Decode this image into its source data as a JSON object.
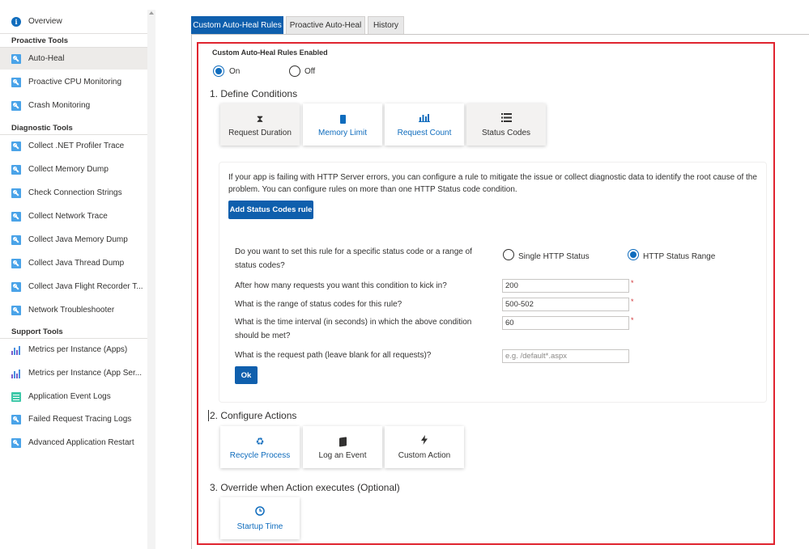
{
  "sidebar": {
    "overview": "Overview",
    "sections": {
      "proactive": "Proactive Tools",
      "diagnostic": "Diagnostic Tools",
      "support": "Support Tools"
    },
    "proactive_items": [
      "Auto-Heal",
      "Proactive CPU Monitoring",
      "Crash Monitoring"
    ],
    "diagnostic_items": [
      "Collect .NET Profiler Trace",
      "Collect Memory Dump",
      "Check Connection Strings",
      "Collect Network Trace",
      "Collect Java Memory Dump",
      "Collect Java Thread Dump",
      "Collect Java Flight Recorder T...",
      "Network Troubleshooter"
    ],
    "support_items": [
      "Metrics per Instance (Apps)",
      "Metrics per Instance (App Ser...",
      "Application Event Logs",
      "Failed Request Tracing Logs",
      "Advanced Application Restart"
    ]
  },
  "tabs": [
    "Custom Auto-Heal Rules",
    "Proactive Auto-Heal",
    "History"
  ],
  "rules": {
    "enabled_label": "Custom Auto-Heal Rules Enabled",
    "on_label": "On",
    "off_label": "Off",
    "enabled": true
  },
  "conditions": {
    "heading": "1. Define Conditions",
    "cards": [
      {
        "label": "Request Duration",
        "icon": "hourglass-icon"
      },
      {
        "label": "Memory Limit",
        "icon": "memory-icon"
      },
      {
        "label": "Request Count",
        "icon": "bar-chart-icon"
      },
      {
        "label": "Status Codes",
        "icon": "list-icon"
      }
    ],
    "selected": [
      "Request Duration",
      "Status Codes"
    ]
  },
  "status_codes": {
    "description_line1": "If your app is failing with HTTP Server errors, you can configure a rule to mitigate the issue or collect diagnostic data to identify the root cause of the",
    "description_line2": "problem. You can configure rules on more than one HTTP Status code condition.",
    "add_button": "Add Status Codes rule",
    "q_type_line1": "Do you want to set this rule for a specific status code or a range of",
    "q_type_line2": "status codes?",
    "single_label": "Single HTTP Status",
    "range_label": "HTTP Status Range",
    "selected_type": "HTTP Status Range",
    "q_requests": "After how many requests you want this condition to kick in?",
    "requests_value": "200",
    "q_range": "What is the range of status codes for this rule?",
    "range_value": "500-502",
    "q_interval_line1": "What is the time interval (in seconds) in which the above condition",
    "q_interval_line2": "should be met?",
    "interval_value": "60",
    "q_path": "What is the request path (leave blank for all requests)?",
    "path_placeholder": "e.g. /default*.aspx",
    "required_mark": "*",
    "ok_button": "Ok"
  },
  "actions": {
    "heading": "2. Configure Actions",
    "cards": [
      {
        "label": "Recycle Process",
        "icon": "recycle-icon"
      },
      {
        "label": "Log an Event",
        "icon": "book-icon"
      },
      {
        "label": "Custom Action",
        "icon": "lightning-icon"
      }
    ]
  },
  "override": {
    "heading": "3. Override when Action executes (Optional)",
    "cards": [
      {
        "label": "Startup Time",
        "icon": "clock-icon"
      }
    ]
  },
  "colors": {
    "accent": "#0f5fad",
    "highlight_border": "#e0242f",
    "link_blue": "#0f6cbd"
  }
}
